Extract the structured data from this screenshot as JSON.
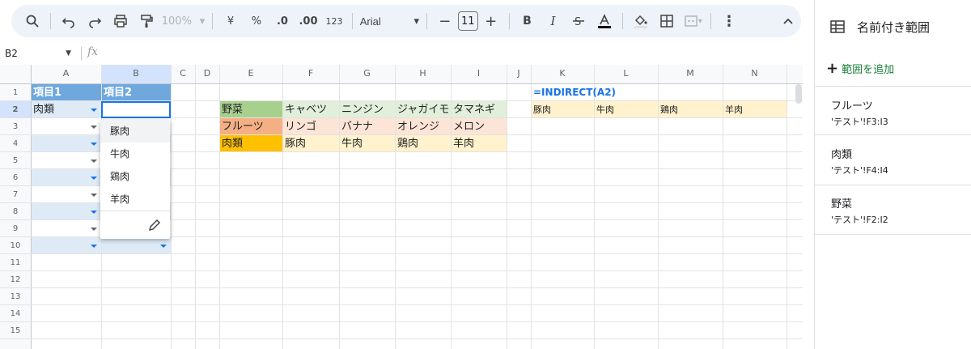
{
  "toolbar": {
    "zoom": "100%",
    "currency": "¥",
    "percent": "%",
    "dec_decrease": ".0",
    "dec_increase": ".00",
    "format_123": "123",
    "font": "Arial",
    "font_size": "11",
    "bold": "B",
    "italic": "I"
  },
  "formula_bar": {
    "name_box": "B2",
    "fx_label": "fx"
  },
  "columns": [
    "A",
    "B",
    "C",
    "D",
    "E",
    "F",
    "G",
    "H",
    "I",
    "J",
    "K",
    "L",
    "M",
    "N"
  ],
  "rows": [
    "1",
    "2",
    "3",
    "4",
    "5",
    "6",
    "7",
    "8",
    "9",
    "10",
    "11",
    "12",
    "13",
    "14",
    "15"
  ],
  "cells": {
    "A1": "項目1",
    "B1": "項目2",
    "A2": "肉類",
    "E2": "野菜",
    "F2": "キャベツ",
    "G2": "ニンジン",
    "H2": "ジャガイモ",
    "I2": "タマネギ",
    "E3": "フルーツ",
    "F3": "リンゴ",
    "G3": "バナナ",
    "H3": "オレンジ",
    "I3": "メロン",
    "E4": "肉類",
    "F4": "豚肉",
    "G4": "牛肉",
    "H4": "鶏肉",
    "I4": "羊肉",
    "K1": "=INDIRECT(A2)",
    "K2": "豚肉",
    "L2": "牛肉",
    "M2": "鶏肉",
    "N2": "羊肉"
  },
  "dropdown_options": [
    "豚肉",
    "牛肉",
    "鶏肉",
    "羊肉"
  ],
  "panel": {
    "title": "名前付き範囲",
    "add_range": "範囲を追加",
    "ranges": [
      {
        "name": "フルーツ",
        "ref": "'テスト'!F3:I3"
      },
      {
        "name": "肉類",
        "ref": "'テスト'!F4:I4"
      },
      {
        "name": "野菜",
        "ref": "'テスト'!F2:I2"
      }
    ]
  },
  "colors": {
    "header_blue": "#6fa8dc",
    "dropdown_cell": "#deebf7",
    "veg_green": "#a8d08d",
    "veg_light": "#e2efda",
    "fruit_orange": "#f4b084",
    "fruit_light": "#fce4d6",
    "meat_amber": "#ffc000",
    "meat_light": "#fff2cc",
    "accent_blue": "#1a73e8",
    "add_green": "#188038"
  }
}
